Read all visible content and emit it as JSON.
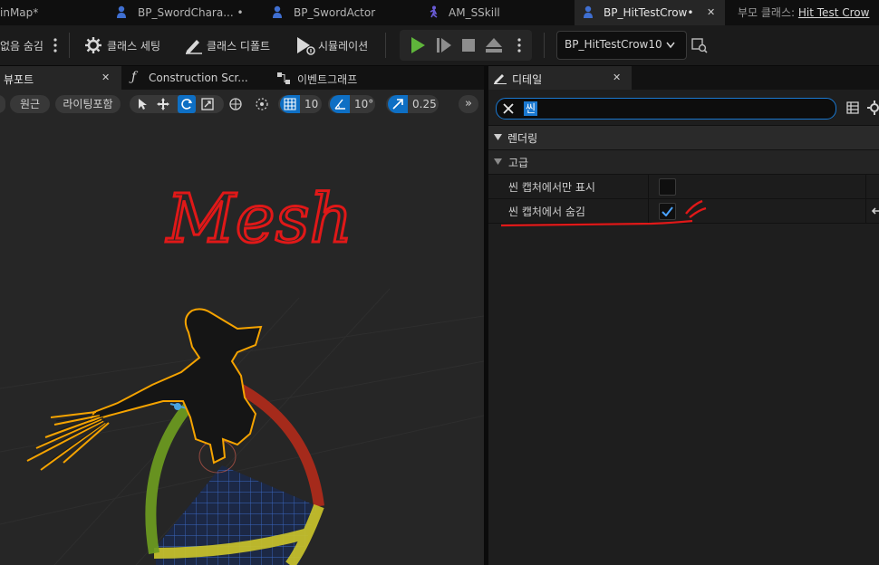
{
  "tabs": [
    {
      "label": "inMap*"
    },
    {
      "label": "BP_SwordChara... •"
    },
    {
      "label": "BP_SwordActor"
    },
    {
      "label": "AM_SSkill"
    },
    {
      "label": "BP_HitTestCrow•"
    }
  ],
  "tab_close": "✕",
  "parent_class": {
    "prefix": "부모 클래스:",
    "link": "Hit Test Crow"
  },
  "toolbar": {
    "hide_label": "없음 숨김",
    "class_settings": "클래스 세팅",
    "class_defaults": "클래스 디폴트",
    "simulation": "시뮬레이션",
    "debug_object": "BP_HitTestCrow10"
  },
  "left_tabs": [
    {
      "label": "뷰포트"
    },
    {
      "label": "Construction Scr..."
    },
    {
      "label": "이벤트그래프"
    }
  ],
  "viewport_toolbar": {
    "perspective": "원근",
    "lighting": "라이팅포함",
    "grid_value": "10",
    "angle_value": "10°",
    "scale_value": "0.25",
    "more": "»"
  },
  "annotation": {
    "text": "Mesh"
  },
  "details": {
    "tab_label": "디테일",
    "search_value": "씬",
    "categories": [
      {
        "label": "렌더링"
      },
      {
        "label": "고급"
      }
    ],
    "properties": [
      {
        "label": "씬 캡처에서만 표시",
        "checked": false
      },
      {
        "label": "씬 캡처에서 숨김",
        "checked": true
      }
    ]
  },
  "colors": {
    "accent_blue": "#0e6fc4",
    "play_green": "#5fb53b",
    "annotation_red": "#e01818",
    "selection_orange": "#f5a300"
  }
}
